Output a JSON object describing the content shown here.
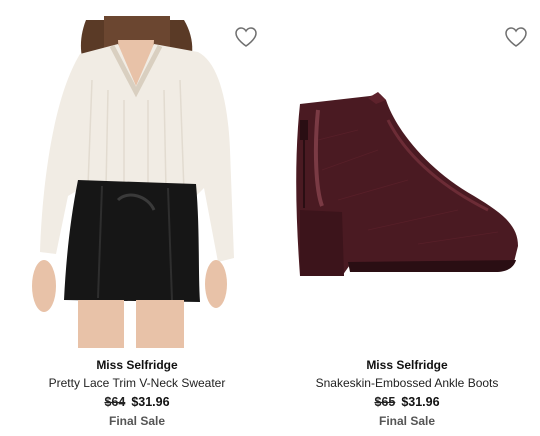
{
  "products": [
    {
      "brand": "Miss Selfridge",
      "name": "Pretty Lace Trim V-Neck Sweater",
      "original_price": "$64",
      "sale_price": "$31.96",
      "tag": "Final Sale",
      "favorite_icon": "heart-outline-icon",
      "image_subject": "model wearing cream lace sweater and black leather mini skirt"
    },
    {
      "brand": "Miss Selfridge",
      "name": "Snakeskin-Embossed Ankle Boots",
      "original_price": "$65",
      "sale_price": "$31.96",
      "tag": "Final Sale",
      "favorite_icon": "heart-outline-icon",
      "image_subject": "burgundy snakeskin block-heel ankle boot"
    }
  ],
  "colors": {
    "boot": "#4a1a22",
    "sweater": "#f1ece4",
    "skirt": "#161616",
    "skin": "#e8c2a8",
    "hair": "#5a3a26"
  }
}
